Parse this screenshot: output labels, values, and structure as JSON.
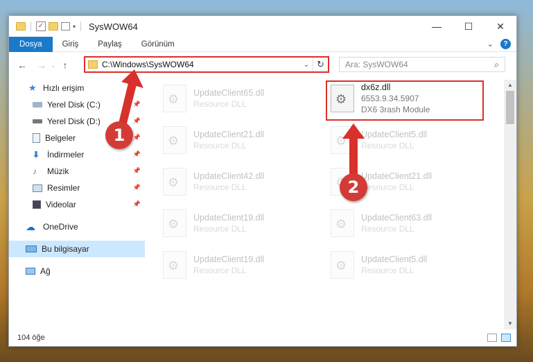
{
  "window": {
    "title": "SysWOW64",
    "controls": {
      "minimize": "—",
      "maximize": "☐",
      "close": "✕"
    }
  },
  "ribbon": {
    "tabs": [
      "Dosya",
      "Giriş",
      "Paylaş",
      "Görünüm"
    ],
    "collapse_icon": "chevron-down-icon",
    "help_label": "?"
  },
  "navigation": {
    "address": "C:\\Windows\\SysWOW64",
    "search_placeholder": "Ara: SysWOW64",
    "back": "←",
    "forward": "→",
    "up": "↑"
  },
  "sidebar": {
    "items": [
      {
        "label": "Hızlı erişim",
        "icon": "star-icon",
        "pinned": false
      },
      {
        "label": "Yerel Disk (C:)",
        "icon": "drive-icon",
        "pinned": true
      },
      {
        "label": "Yerel Disk (D:)",
        "icon": "drive-icon",
        "pinned": true
      },
      {
        "label": "Belgeler",
        "icon": "documents-icon",
        "pinned": true
      },
      {
        "label": "İndirmeler",
        "icon": "download-icon",
        "pinned": true
      },
      {
        "label": "Müzik",
        "icon": "music-icon",
        "pinned": true
      },
      {
        "label": "Resimler",
        "icon": "pictures-icon",
        "pinned": true
      },
      {
        "label": "Videolar",
        "icon": "videos-icon",
        "pinned": true
      },
      {
        "label": "OneDrive",
        "icon": "cloud-icon",
        "pinned": false
      },
      {
        "label": "Bu bilgisayar",
        "icon": "computer-icon",
        "pinned": false,
        "selected": true
      },
      {
        "label": "Ağ",
        "icon": "network-icon",
        "pinned": false
      }
    ]
  },
  "files": {
    "highlighted": {
      "name": "dx6z.dll",
      "version": "6553.9.34.5907",
      "description": "DX6 3rash Module"
    },
    "left_column": [
      {
        "name": "UpdateClient65.dll",
        "type": "Resource DLL"
      },
      {
        "name": "UpdateClient21.dll",
        "type": "Resource DLL"
      },
      {
        "name": "UpdateClient42.dll",
        "type": "Resource DLL"
      },
      {
        "name": "UpdateClient19.dll",
        "type": "Resource DLL"
      },
      {
        "name": "UpdateClient19.dll",
        "type": "Resource DLL"
      }
    ],
    "right_column": [
      {
        "name": "UpdateClient5.dll",
        "type": "Resource DLL"
      },
      {
        "name": "UpdateClient21.dll",
        "type": "Resource DLL"
      },
      {
        "name": "UpdateClient63.dll",
        "type": "Resource DLL"
      },
      {
        "name": "UpdateClient5.dll",
        "type": "Resource DLL"
      }
    ]
  },
  "status": {
    "item_count": "104 öğe"
  },
  "annotations": {
    "badge_1": "1",
    "badge_2": "2",
    "color": "#d9302c"
  }
}
